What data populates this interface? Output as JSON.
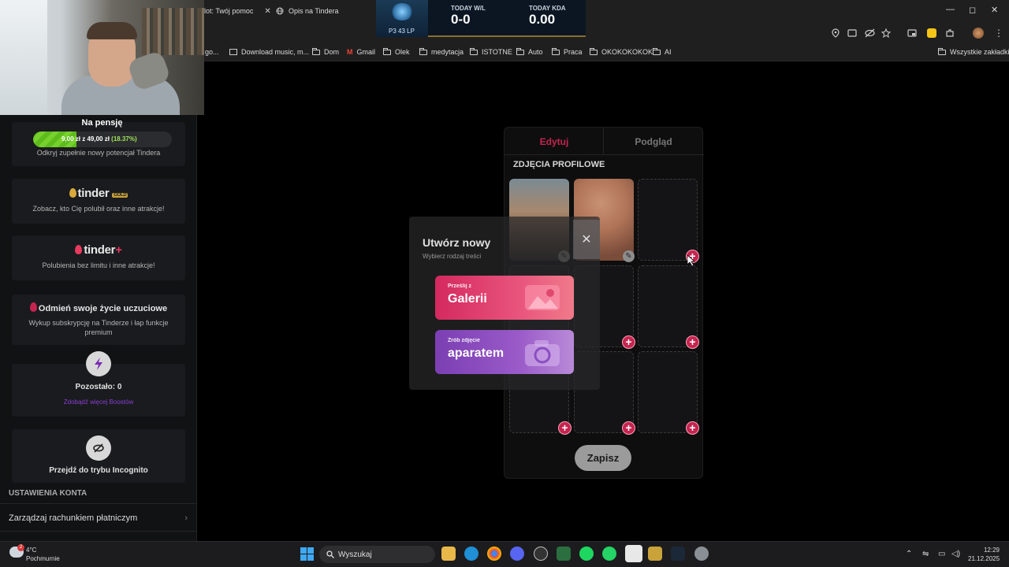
{
  "browser": {
    "tabs": [
      {
        "label": "lot: Twój pomoc",
        "close": "✕"
      },
      {
        "label": "Opis na Tindera"
      }
    ],
    "window_controls": [
      "—",
      "◻",
      "✕"
    ],
    "bookmarks": [
      {
        "label": "go..."
      },
      {
        "label": "Download music, m..."
      },
      {
        "label": "Dom"
      },
      {
        "label": "Gmail"
      },
      {
        "label": "Olek"
      },
      {
        "label": "medytacja"
      },
      {
        "label": "ISTOTNE"
      },
      {
        "label": "Auto"
      },
      {
        "label": "Praca"
      },
      {
        "label": "OKOKOKOKOK"
      },
      {
        "label": "AI"
      }
    ],
    "all_bookmarks": "Wszystkie zakładki"
  },
  "lol_overlay": {
    "lp": "P3 43 LP",
    "wl_label": "TODAY W/L",
    "wl_value": "0-0",
    "kda_label": "TODAY KDA",
    "kda_value": "0.00"
  },
  "stream_goal": {
    "title": "Na pensję",
    "text": "9,00 zł z 49,00 zł",
    "percent_text": "(18.37%)",
    "progress": 0.1837
  },
  "sidebar": {
    "platinum_sub": "Odkryj zupełnie nowy potencjał Tindera",
    "gold_logo": "tinder",
    "gold_badge": "GOLD",
    "gold_sub": "Zobacz, kto Cię polubił oraz inne atrakcje!",
    "plus_logo": "tinder",
    "plus_mark": "+",
    "plus_sub": "Polubienia bez limitu i inne atrakcje!",
    "change_title": "Odmień swoje życie uczuciowe",
    "change_sub": "Wykup subskrypcję na Tinderze i łap funkcje premium",
    "boost_left": "Pozostało: 0",
    "boost_link": "Zdobądź więcej Boostów",
    "incognito": "Przejdź do trybu Incognito",
    "settings_title": "USTAWIENIA KONTA",
    "settings_item": "Zarządzaj rachunkiem płatniczym"
  },
  "editor": {
    "tab_edit": "Edytuj",
    "tab_preview": "Podgląd",
    "section_title": "ZDJĘCIA PROFILOWE",
    "plus": "+",
    "save": "Zapisz",
    "accent": "#c4254f"
  },
  "modal": {
    "title": "Utwórz nowy",
    "subtitle": "Wybierz rodzaj treści",
    "close": "✕",
    "gallery_small": "Prześlij z",
    "gallery_big": "Galerii",
    "camera_small": "Zrób zdjęcie",
    "camera_big": "aparatem"
  },
  "taskbar": {
    "temperature": "4°C",
    "condition": "Pochmurnie",
    "weather_badge": "2",
    "search": "Wyszukaj",
    "time": "12:29",
    "date": "21.12.2025"
  }
}
